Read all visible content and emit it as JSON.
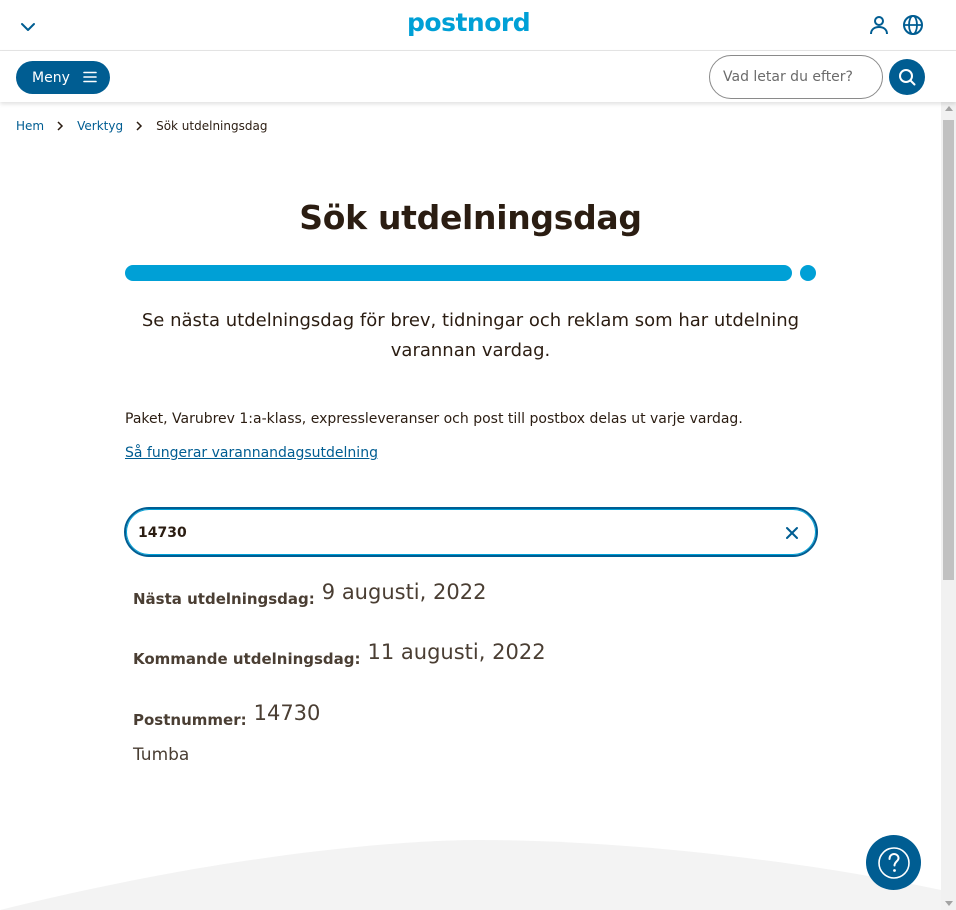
{
  "header": {
    "logo": "postnord",
    "menu_label": "Meny",
    "search_placeholder": "Vad letar du efter?"
  },
  "breadcrumb": {
    "items": [
      "Hem",
      "Verktyg",
      "Sök utdelningsdag"
    ]
  },
  "main": {
    "title": "Sök utdelningsdag",
    "progress_percent": 100,
    "intro": "Se nästa utdelningsdag för brev, tidningar och reklam som har utdelning varannan vardag.",
    "info": "Paket, Varubrev 1:a-klass, expressleveranser och post till postbox delas ut varje vardag.",
    "how_link": "Så fungerar varannandagsutdelning",
    "postal_code_value": "14730"
  },
  "results": {
    "next_label": "Nästa utdelningsdag:",
    "next_value": "9 augusti, 2022",
    "upcoming_label": "Kommande utdelningsdag:",
    "upcoming_value": "11 augusti, 2022",
    "postal_label": "Postnummer:",
    "postal_value": "14730",
    "city": "Tumba"
  },
  "colors": {
    "brand_blue": "#00a0d6",
    "dark_blue": "#005d92",
    "text": "#2b1d12"
  },
  "icons": [
    "chevron-down-icon",
    "user-icon",
    "globe-icon",
    "menu-icon",
    "search-icon",
    "chevron-right-icon",
    "close-icon",
    "help-icon"
  ]
}
